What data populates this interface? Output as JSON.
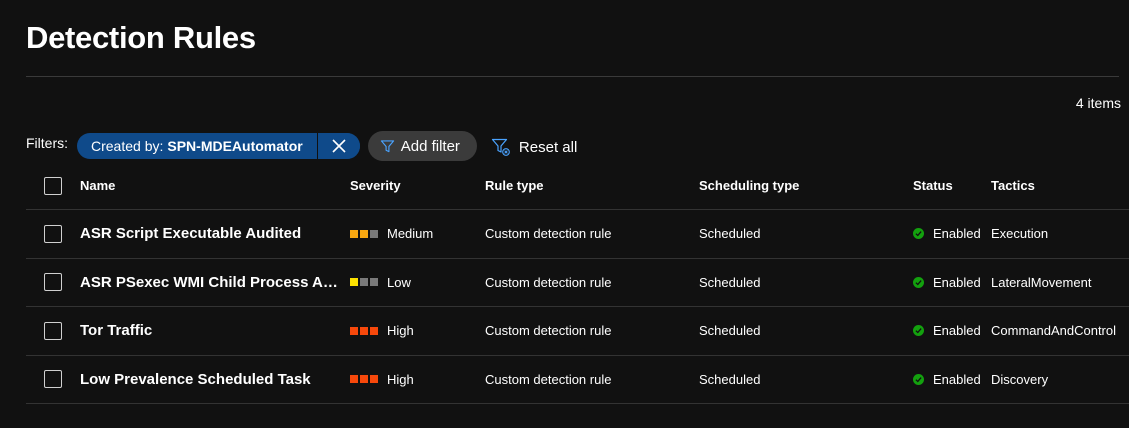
{
  "header": {
    "title": "Detection Rules",
    "item_count": "4 items"
  },
  "filters": {
    "label": "Filters:",
    "active_filter": {
      "key": "Created by:",
      "value": "SPN-MDEAutomator"
    },
    "add_filter_label": "Add filter",
    "reset_all_label": "Reset all"
  },
  "table": {
    "columns": {
      "name": "Name",
      "severity": "Severity",
      "rule_type": "Rule type",
      "scheduling_type": "Scheduling type",
      "status": "Status",
      "tactics": "Tactics"
    },
    "rows": [
      {
        "name": "ASR Script Executable Audited",
        "severity": "Medium",
        "severity_colors": [
          "#f7a711",
          "#f7a711",
          "#7a7a7a"
        ],
        "rule_type": "Custom detection rule",
        "scheduling_type": "Scheduled",
        "status": "Enabled",
        "tactics": "Execution"
      },
      {
        "name": "ASR PSexec WMI Child Process Au...",
        "severity": "Low",
        "severity_colors": [
          "#fce100",
          "#7a7a7a",
          "#7a7a7a"
        ],
        "rule_type": "Custom detection rule",
        "scheduling_type": "Scheduled",
        "status": "Enabled",
        "tactics": "LateralMovement"
      },
      {
        "name": "Tor Traffic",
        "severity": "High",
        "severity_colors": [
          "#f7480b",
          "#f7480b",
          "#f7480b"
        ],
        "rule_type": "Custom detection rule",
        "scheduling_type": "Scheduled",
        "status": "Enabled",
        "tactics": "CommandAndControl"
      },
      {
        "name": "Low Prevalence Scheduled Task",
        "severity": "High",
        "severity_colors": [
          "#f7480b",
          "#f7480b",
          "#f7480b"
        ],
        "rule_type": "Custom detection rule",
        "scheduling_type": "Scheduled",
        "status": "Enabled",
        "tactics": "Discovery"
      }
    ]
  },
  "colors": {
    "background": "#111111",
    "pill_blue": "#0f4a8a",
    "link_blue": "#4aa3ff",
    "status_green": "#13a10e",
    "divider": "#333333"
  },
  "icons": {
    "close": "close-icon",
    "filter": "filter-icon",
    "reset": "filter-reset-icon",
    "status": "check-circle-icon"
  }
}
